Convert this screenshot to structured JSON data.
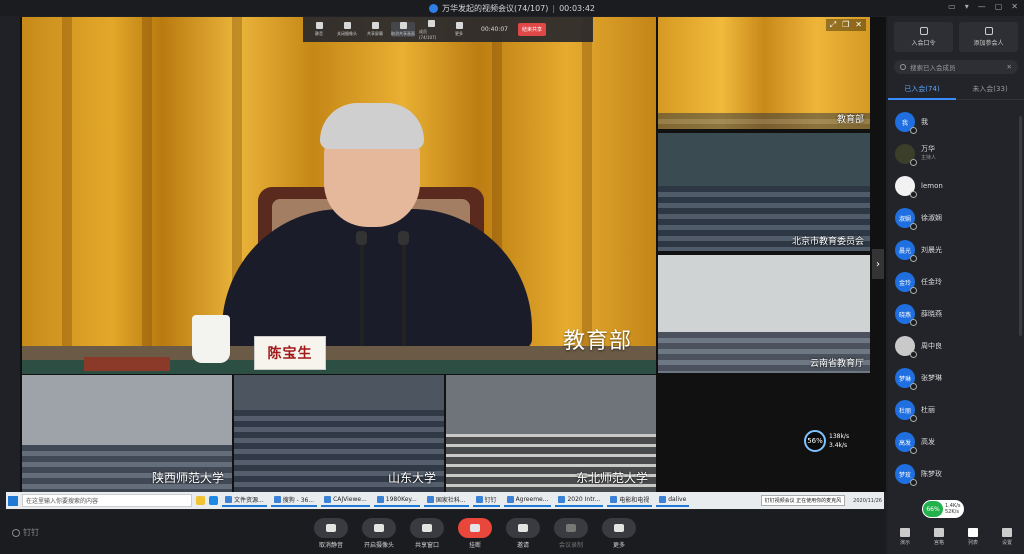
{
  "window": {
    "title": "万华发起的视频会议(74/107)",
    "timer": "00:03:42",
    "controls": [
      "▭",
      "▾",
      "—",
      "▢",
      "✕"
    ]
  },
  "toolbar": {
    "buttons": [
      {
        "label": "静音",
        "icon": "mic-icon"
      },
      {
        "label": "关闭摄像头",
        "icon": "camera-icon"
      },
      {
        "label": "共享屏幕",
        "icon": "share-icon"
      },
      {
        "label": "取消共享画面",
        "icon": "layout-icon"
      },
      {
        "label": "成员(74/107)",
        "icon": "members-icon"
      },
      {
        "label": "更多",
        "icon": "more-icon"
      }
    ],
    "countdown": "00:40:07",
    "end_label": "结束共享"
  },
  "stage": {
    "main": {
      "label": "教育部",
      "nameplate": "陈宝生"
    },
    "side_tiles": [
      {
        "label": "教育部"
      },
      {
        "label": "北京市教育委员会"
      },
      {
        "label": "云南省教育厅"
      }
    ],
    "bottom_tiles": [
      {
        "label": "陕西师范大学"
      },
      {
        "label": "山东大学"
      },
      {
        "label": "东北师范大学"
      }
    ],
    "net": {
      "percent": "56%",
      "up": "138k/s",
      "down": "3.4k/s"
    }
  },
  "taskbar": {
    "search_placeholder": "在这里输入你要搜索的内容",
    "apps": [
      "文件资源...",
      "搜狗 - 36...",
      "CAJViewe...",
      "1980Key...",
      "国家社科...",
      "钉钉",
      "Agreeme...",
      "2020 Intr...",
      "电影和电视",
      "dalive"
    ],
    "notify": "钉钉视频会议 正在使用你的麦克风",
    "date": "2020/11/26"
  },
  "control_bar": {
    "brand": "钉钉",
    "buttons": [
      {
        "label": "取消静音",
        "icon": "mic-off-icon"
      },
      {
        "label": "开启摄像头",
        "icon": "camera-off-icon"
      },
      {
        "label": "共享窗口",
        "icon": "share-screen-icon"
      },
      {
        "label": "挂断",
        "icon": "hangup-icon"
      },
      {
        "label": "邀请",
        "icon": "invite-icon"
      },
      {
        "label": "会议录制",
        "icon": "record-icon"
      },
      {
        "label": "更多",
        "icon": "more-icon"
      }
    ]
  },
  "panel": {
    "actions": [
      {
        "label": "入会口令",
        "icon": "key-icon"
      },
      {
        "label": "添加参会人",
        "icon": "add-user-icon"
      }
    ],
    "search_placeholder": "搜索已入会成员",
    "tabs": [
      "已入会(74)",
      "未入会(33)"
    ],
    "members": [
      {
        "avatar": "我",
        "name": "我",
        "sub": "",
        "color": "#1f6fe0"
      },
      {
        "avatar": "",
        "name": "万华",
        "sub": "主持人",
        "color": "#3b3f2a"
      },
      {
        "avatar": "",
        "name": "lemon",
        "sub": "",
        "color": "#f2f2f2"
      },
      {
        "avatar": "淑娴",
        "name": "徐淑娴",
        "sub": "",
        "color": "#1f6fe0"
      },
      {
        "avatar": "晨光",
        "name": "刘晨光",
        "sub": "",
        "color": "#1f6fe0"
      },
      {
        "avatar": "金玲",
        "name": "任金玲",
        "sub": "",
        "color": "#1f6fe0"
      },
      {
        "avatar": "晓燕",
        "name": "薛晓燕",
        "sub": "",
        "color": "#1f6fe0"
      },
      {
        "avatar": "",
        "name": "周中良",
        "sub": "",
        "color": "#c9c9c9"
      },
      {
        "avatar": "梦琳",
        "name": "张梦琳",
        "sub": "",
        "color": "#1f6fe0"
      },
      {
        "avatar": "杜丽",
        "name": "杜丽",
        "sub": "",
        "color": "#1f6fe0"
      },
      {
        "avatar": "高发",
        "name": "高发",
        "sub": "",
        "color": "#1f6fe0"
      },
      {
        "avatar": "梦玫",
        "name": "陈梦玫",
        "sub": "",
        "color": "#1f6fe0"
      }
    ],
    "bottom": [
      {
        "label": "演示",
        "icon": "present-icon"
      },
      {
        "label": "宫格",
        "icon": "grid-icon"
      },
      {
        "label": "列表",
        "icon": "list-icon"
      },
      {
        "label": "设置",
        "icon": "gear-icon"
      }
    ],
    "speed": {
      "percent": "66%",
      "up": "1.4K/s",
      "down": "52K/s"
    }
  }
}
